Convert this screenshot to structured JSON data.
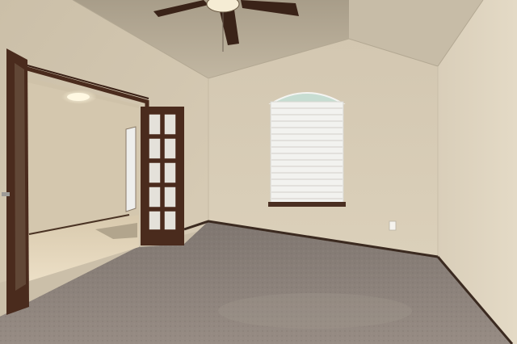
{
  "scene": {
    "kind": "photo",
    "subject": "vacant-bedroom",
    "colors": {
      "ceiling": "#bdb29d",
      "left_wall": "#d2c6b1",
      "back_wall": "#d8ccb6",
      "right_wall": "#ddd2bd",
      "carpet": "#8e847c",
      "baseboard": "#3b2a20",
      "door_wood": "#4a2b1d",
      "blind": "#f2f2ef",
      "hall_floor": "#e6d8bd",
      "fan_blade": "#3a2318"
    }
  }
}
